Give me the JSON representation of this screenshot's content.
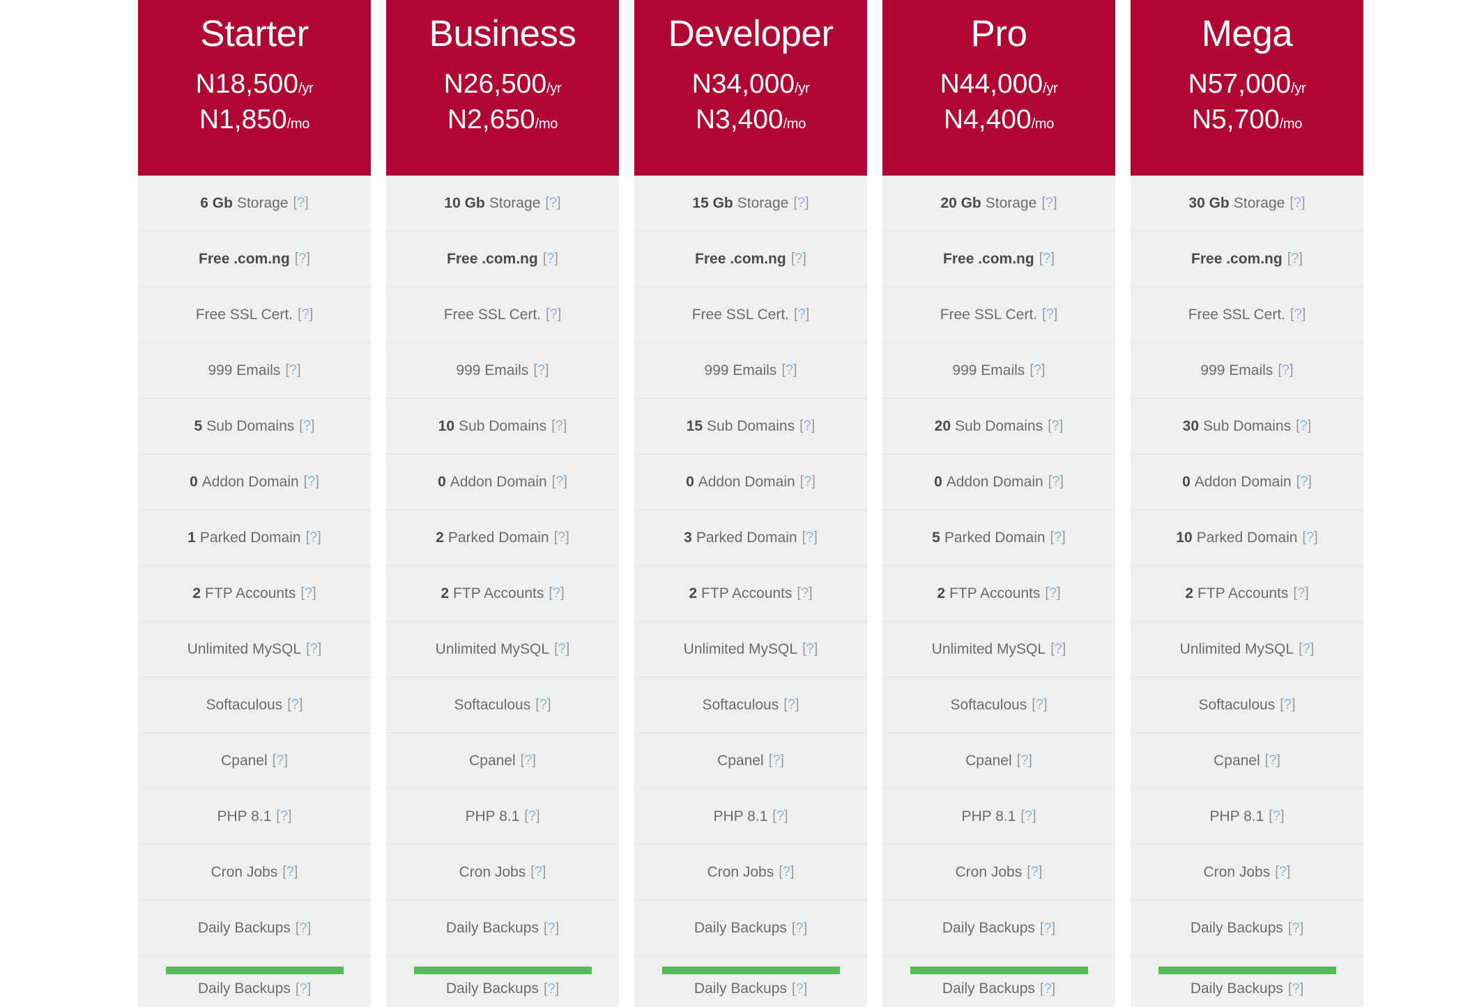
{
  "theme": {
    "header_bg": "#b00634",
    "header_text": "#ffffff",
    "row_bg": "#f0f0f0",
    "row_border": "#e2e2e2",
    "label_color": "#6b6b6b",
    "value_color": "#4a4a4a",
    "help_color": "#8fb6d4",
    "cta_bar_color": "#5cb85c"
  },
  "help_icon": {
    "open_bracket": "[",
    "question": "?",
    "close_bracket": "]",
    "name": "help-question-icon"
  },
  "plans": [
    {
      "name": "Starter",
      "price_yearly": "N18,500",
      "period_yearly": "/yr",
      "price_monthly": "N1,850",
      "period_monthly": "/mo",
      "features": [
        {
          "value": "6 Gb",
          "label": "Storage",
          "bold_label": false
        },
        {
          "value": "",
          "label": "Free .com.ng",
          "bold_label": true
        },
        {
          "value": "",
          "label": "Free SSL Cert.",
          "bold_label": false
        },
        {
          "value": "",
          "label": "999 Emails",
          "bold_label": false
        },
        {
          "value": "5",
          "label": "Sub Domains",
          "bold_label": false
        },
        {
          "value": "0",
          "label": "Addon Domain",
          "bold_label": false
        },
        {
          "value": "1",
          "label": "Parked Domain",
          "bold_label": false
        },
        {
          "value": "2",
          "label": "FTP Accounts",
          "bold_label": false
        },
        {
          "value": "",
          "label": "Unlimited MySQL",
          "bold_label": false
        },
        {
          "value": "",
          "label": "Softaculous",
          "bold_label": false
        },
        {
          "value": "",
          "label": "Cpanel",
          "bold_label": false
        },
        {
          "value": "",
          "label": "PHP 8.1",
          "bold_label": false
        },
        {
          "value": "",
          "label": "Cron Jobs",
          "bold_label": false
        },
        {
          "value": "",
          "label": "Daily Backups",
          "bold_label": false
        }
      ],
      "cta_label": "Daily Backups"
    },
    {
      "name": "Business",
      "price_yearly": "N26,500",
      "period_yearly": "/yr",
      "price_monthly": "N2,650",
      "period_monthly": "/mo",
      "features": [
        {
          "value": "10 Gb",
          "label": "Storage",
          "bold_label": false
        },
        {
          "value": "",
          "label": "Free .com.ng",
          "bold_label": true
        },
        {
          "value": "",
          "label": "Free SSL Cert.",
          "bold_label": false
        },
        {
          "value": "",
          "label": "999 Emails",
          "bold_label": false
        },
        {
          "value": "10",
          "label": "Sub Domains",
          "bold_label": false
        },
        {
          "value": "0",
          "label": "Addon Domain",
          "bold_label": false
        },
        {
          "value": "2",
          "label": "Parked Domain",
          "bold_label": false
        },
        {
          "value": "2",
          "label": "FTP Accounts",
          "bold_label": false
        },
        {
          "value": "",
          "label": "Unlimited MySQL",
          "bold_label": false
        },
        {
          "value": "",
          "label": "Softaculous",
          "bold_label": false
        },
        {
          "value": "",
          "label": "Cpanel",
          "bold_label": false
        },
        {
          "value": "",
          "label": "PHP 8.1",
          "bold_label": false
        },
        {
          "value": "",
          "label": "Cron Jobs",
          "bold_label": false
        },
        {
          "value": "",
          "label": "Daily Backups",
          "bold_label": false
        }
      ],
      "cta_label": "Daily Backups"
    },
    {
      "name": "Developer",
      "price_yearly": "N34,000",
      "period_yearly": "/yr",
      "price_monthly": "N3,400",
      "period_monthly": "/mo",
      "features": [
        {
          "value": "15 Gb",
          "label": "Storage",
          "bold_label": false
        },
        {
          "value": "",
          "label": "Free .com.ng",
          "bold_label": true
        },
        {
          "value": "",
          "label": "Free SSL Cert.",
          "bold_label": false
        },
        {
          "value": "",
          "label": "999 Emails",
          "bold_label": false
        },
        {
          "value": "15",
          "label": "Sub Domains",
          "bold_label": false
        },
        {
          "value": "0",
          "label": "Addon Domain",
          "bold_label": false
        },
        {
          "value": "3",
          "label": "Parked Domain",
          "bold_label": false
        },
        {
          "value": "2",
          "label": "FTP Accounts",
          "bold_label": false
        },
        {
          "value": "",
          "label": "Unlimited MySQL",
          "bold_label": false
        },
        {
          "value": "",
          "label": "Softaculous",
          "bold_label": false
        },
        {
          "value": "",
          "label": "Cpanel",
          "bold_label": false
        },
        {
          "value": "",
          "label": "PHP 8.1",
          "bold_label": false
        },
        {
          "value": "",
          "label": "Cron Jobs",
          "bold_label": false
        },
        {
          "value": "",
          "label": "Daily Backups",
          "bold_label": false
        }
      ],
      "cta_label": "Daily Backups"
    },
    {
      "name": "Pro",
      "price_yearly": "N44,000",
      "period_yearly": "/yr",
      "price_monthly": "N4,400",
      "period_monthly": "/mo",
      "features": [
        {
          "value": "20 Gb",
          "label": "Storage",
          "bold_label": false
        },
        {
          "value": "",
          "label": "Free .com.ng",
          "bold_label": true
        },
        {
          "value": "",
          "label": "Free SSL Cert.",
          "bold_label": false
        },
        {
          "value": "",
          "label": "999 Emails",
          "bold_label": false
        },
        {
          "value": "20",
          "label": "Sub Domains",
          "bold_label": false
        },
        {
          "value": "0",
          "label": "Addon Domain",
          "bold_label": false
        },
        {
          "value": "5",
          "label": "Parked Domain",
          "bold_label": false
        },
        {
          "value": "2",
          "label": "FTP Accounts",
          "bold_label": false
        },
        {
          "value": "",
          "label": "Unlimited MySQL",
          "bold_label": false
        },
        {
          "value": "",
          "label": "Softaculous",
          "bold_label": false
        },
        {
          "value": "",
          "label": "Cpanel",
          "bold_label": false
        },
        {
          "value": "",
          "label": "PHP 8.1",
          "bold_label": false
        },
        {
          "value": "",
          "label": "Cron Jobs",
          "bold_label": false
        },
        {
          "value": "",
          "label": "Daily Backups",
          "bold_label": false
        }
      ],
      "cta_label": "Daily Backups"
    },
    {
      "name": "Mega",
      "price_yearly": "N57,000",
      "period_yearly": "/yr",
      "price_monthly": "N5,700",
      "period_monthly": "/mo",
      "features": [
        {
          "value": "30 Gb",
          "label": "Storage",
          "bold_label": false
        },
        {
          "value": "",
          "label": "Free .com.ng",
          "bold_label": true
        },
        {
          "value": "",
          "label": "Free SSL Cert.",
          "bold_label": false
        },
        {
          "value": "",
          "label": "999 Emails",
          "bold_label": false
        },
        {
          "value": "30",
          "label": "Sub Domains",
          "bold_label": false
        },
        {
          "value": "0",
          "label": "Addon Domain",
          "bold_label": false
        },
        {
          "value": "10",
          "label": "Parked Domain",
          "bold_label": false
        },
        {
          "value": "2",
          "label": "FTP Accounts",
          "bold_label": false
        },
        {
          "value": "",
          "label": "Unlimited MySQL",
          "bold_label": false
        },
        {
          "value": "",
          "label": "Softaculous",
          "bold_label": false
        },
        {
          "value": "",
          "label": "Cpanel",
          "bold_label": false
        },
        {
          "value": "",
          "label": "PHP 8.1",
          "bold_label": false
        },
        {
          "value": "",
          "label": "Cron Jobs",
          "bold_label": false
        },
        {
          "value": "",
          "label": "Daily Backups",
          "bold_label": false
        }
      ],
      "cta_label": "Daily Backups"
    }
  ]
}
